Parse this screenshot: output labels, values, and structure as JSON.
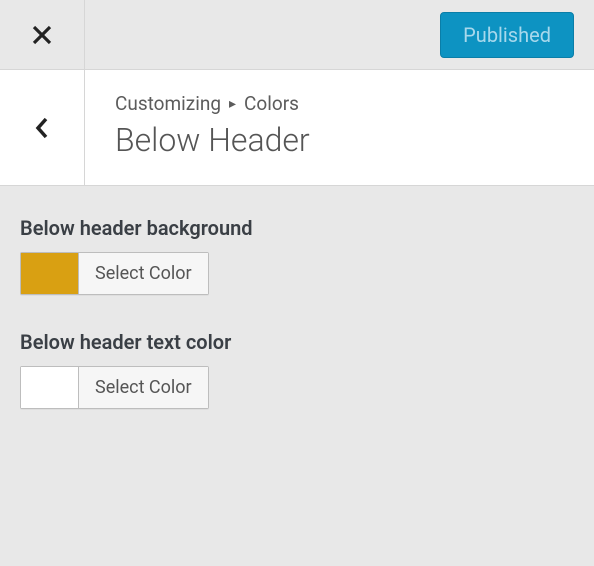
{
  "topbar": {
    "publish_label": "Published"
  },
  "breadcrumb": {
    "root": "Customizing",
    "parent": "Colors"
  },
  "section_title": "Below Header",
  "controls": [
    {
      "label": "Below header background",
      "button_label": "Select Color",
      "swatch_color": "#d9a012"
    },
    {
      "label": "Below header text color",
      "button_label": "Select Color",
      "swatch_color": "#ffffff"
    }
  ]
}
